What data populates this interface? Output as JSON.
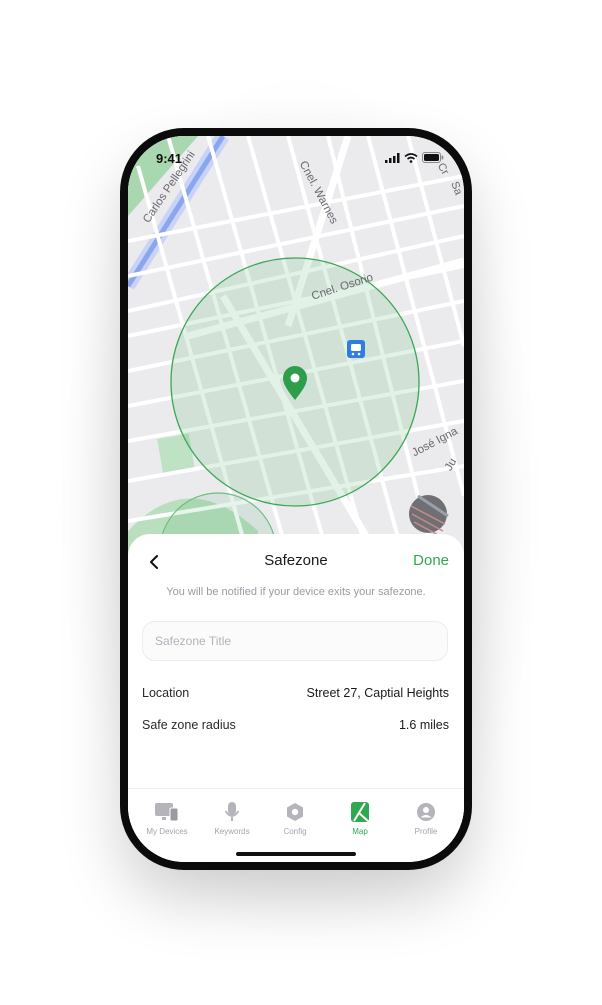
{
  "status_bar": {
    "time": "9:41"
  },
  "map": {
    "street_labels": [
      "Carlos Pellegrini",
      "Cnel. Warnes",
      "Cnel. Osorio",
      "José Igna",
      "Ju",
      "Cr",
      "Sa"
    ],
    "safezone_color": "#3aa757",
    "icons": [
      "location-pin-icon",
      "train-station-icon",
      "map-style-thumbnail"
    ]
  },
  "sheet": {
    "back_icon": "chevron-left-icon",
    "title": "Safezone",
    "done_label": "Done",
    "hint": "You will be notified if your device exits your safezone.",
    "title_input": {
      "placeholder": "Safezone Title",
      "value": ""
    },
    "location_label": "Location",
    "location_value": "Street 27, Captial Heights",
    "radius_label": "Safe zone radius",
    "radius_value": "1.6 miles",
    "radius_fraction": 0.365
  },
  "tabbar": {
    "accent": "#2fa84f",
    "items": [
      {
        "label": "My Devices",
        "icon": "devices-icon"
      },
      {
        "label": "Keywords",
        "icon": "microphone-icon"
      },
      {
        "label": "Config",
        "icon": "hexagon-settings-icon"
      },
      {
        "label": "Map",
        "icon": "map-icon"
      },
      {
        "label": "Profile",
        "icon": "profile-icon"
      }
    ],
    "active_index": 3
  }
}
